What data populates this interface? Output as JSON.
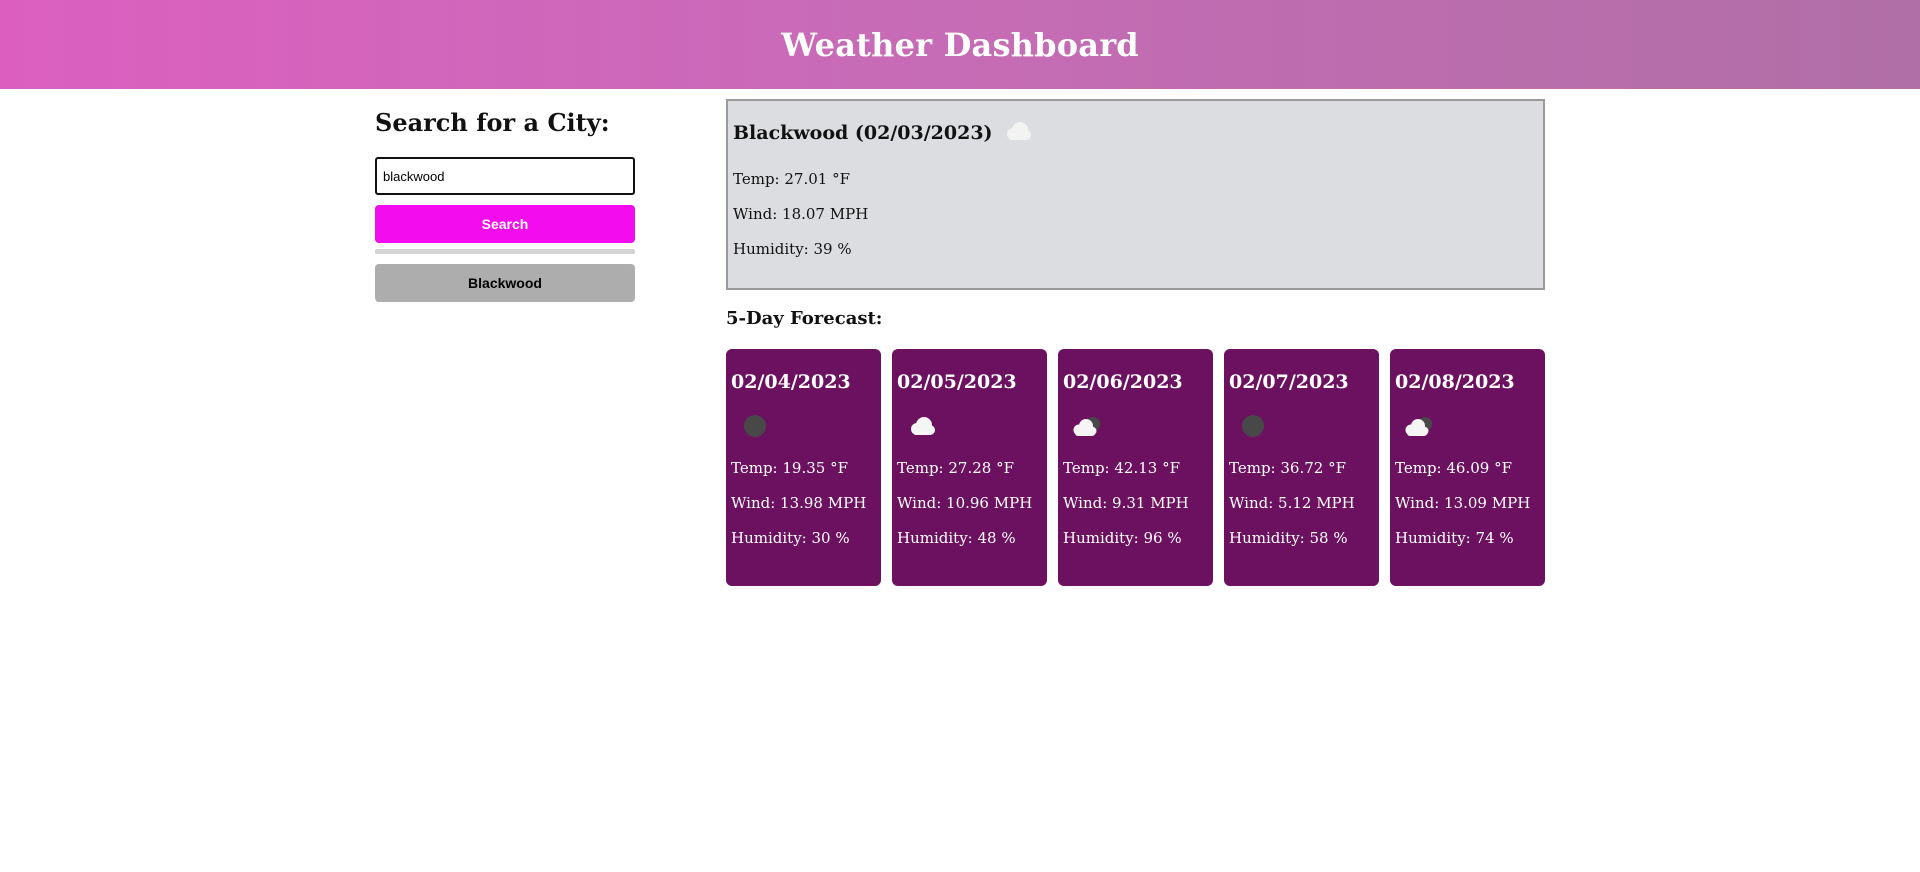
{
  "header": {
    "title": "Weather Dashboard"
  },
  "search": {
    "heading": "Search for a City:",
    "input_value": "blackwood",
    "button_label": "Search",
    "history": [
      "Blackwood"
    ]
  },
  "current": {
    "title": "Blackwood (02/03/2023)",
    "icon": "cloud-icon",
    "temp": "Temp: 27.01 °F",
    "wind": "Wind: 18.07 MPH",
    "humidity": "Humidity: 39 %"
  },
  "forecast": {
    "heading": "5-Day Forecast:",
    "days": [
      {
        "date": "02/04/2023",
        "icon": "moon-icon",
        "temp": "Temp: 19.35 °F",
        "wind": "Wind: 13.98 MPH",
        "humidity": "Humidity: 30 %"
      },
      {
        "date": "02/05/2023",
        "icon": "cloud-icon",
        "temp": "Temp: 27.28 °F",
        "wind": "Wind: 10.96 MPH",
        "humidity": "Humidity: 48 %"
      },
      {
        "date": "02/06/2023",
        "icon": "cloudy-night-icon",
        "temp": "Temp: 42.13 °F",
        "wind": "Wind: 9.31 MPH",
        "humidity": "Humidity: 96 %"
      },
      {
        "date": "02/07/2023",
        "icon": "moon-icon",
        "temp": "Temp: 36.72 °F",
        "wind": "Wind: 5.12 MPH",
        "humidity": "Humidity: 58 %"
      },
      {
        "date": "02/08/2023",
        "icon": "cloudy-night-icon",
        "temp": "Temp: 46.09 °F",
        "wind": "Wind: 13.09 MPH",
        "humidity": "Humidity: 74 %"
      }
    ]
  },
  "colors": {
    "header_gradient_start": "#dc5fc0",
    "header_gradient_end": "#b06fa6",
    "search_button": "#f20cee",
    "history_button": "#adadad",
    "current_bg": "#dcdde0",
    "card_bg": "#6b1160"
  }
}
